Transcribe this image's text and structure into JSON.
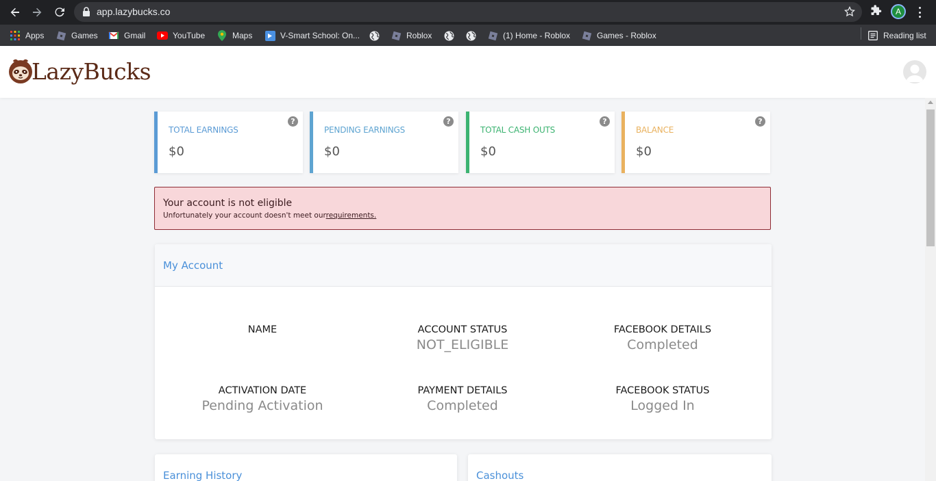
{
  "browser": {
    "url": "app.lazybucks.co",
    "profile_initial": "A",
    "bookmarks": [
      {
        "label": "Apps",
        "icon": "apps-grid-icon"
      },
      {
        "label": "Games",
        "icon": "roblox-icon"
      },
      {
        "label": "Gmail",
        "icon": "gmail-icon"
      },
      {
        "label": "YouTube",
        "icon": "youtube-icon"
      },
      {
        "label": "Maps",
        "icon": "maps-icon"
      },
      {
        "label": "V-Smart School: On...",
        "icon": "vsmart-icon"
      },
      {
        "label": "",
        "icon": "globe-icon"
      },
      {
        "label": "Roblox",
        "icon": "roblox-icon"
      },
      {
        "label": "",
        "icon": "globe-icon"
      },
      {
        "label": "",
        "icon": "globe-icon"
      },
      {
        "label": "(1) Home - Roblox",
        "icon": "roblox-icon"
      },
      {
        "label": "Games - Roblox",
        "icon": "roblox-icon"
      }
    ],
    "reading_list": "Reading list"
  },
  "header": {
    "logo_text": "LazyBucks"
  },
  "stats": [
    {
      "label": "TOTAL EARNINGS",
      "value": "$0",
      "color": "#5b9bd5"
    },
    {
      "label": "PENDING EARNINGS",
      "value": "$0",
      "color": "#5ea4d1"
    },
    {
      "label": "TOTAL CASH OUTS",
      "value": "$0",
      "color": "#3cb371"
    },
    {
      "label": "BALANCE",
      "value": "$0",
      "color": "#e9b15e"
    }
  ],
  "alert": {
    "title": "Your account is not eligible",
    "text": "Unfortunately your account doesn't meet our",
    "link": "requirements."
  },
  "account": {
    "title": "My Account",
    "fields": [
      {
        "label": "NAME",
        "value": ""
      },
      {
        "label": "ACCOUNT STATUS",
        "value": "NOT_ELIGIBLE"
      },
      {
        "label": "FACEBOOK DETAILS",
        "value": "Completed"
      },
      {
        "label": "ACTIVATION DATE",
        "value": "Pending Activation"
      },
      {
        "label": "PAYMENT DETAILS",
        "value": "Completed"
      },
      {
        "label": "FACEBOOK STATUS",
        "value": "Logged In"
      }
    ]
  },
  "panels": {
    "earning_history": "Earning History",
    "cashouts": "Cashouts"
  }
}
